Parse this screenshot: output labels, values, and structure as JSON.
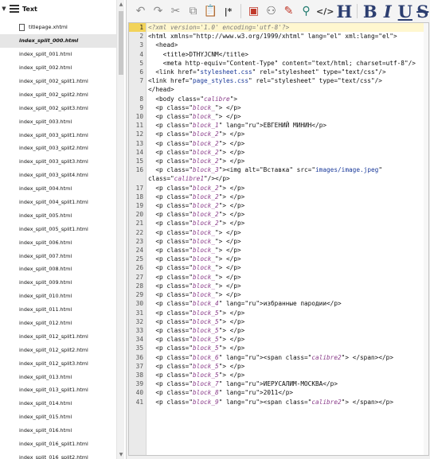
{
  "tree": {
    "root_label": "Text",
    "items": [
      {
        "label": "titlepage.xhtml",
        "selected": false
      },
      {
        "label": "index_split_000.html",
        "selected": true
      },
      {
        "label": "index_split_001.html",
        "selected": false
      },
      {
        "label": "index_split_002.html",
        "selected": false
      },
      {
        "label": "index_split_002_split1.html",
        "selected": false
      },
      {
        "label": "index_split_002_split2.html",
        "selected": false
      },
      {
        "label": "index_split_002_split3.html",
        "selected": false
      },
      {
        "label": "index_split_003.html",
        "selected": false
      },
      {
        "label": "index_split_003_split1.html",
        "selected": false
      },
      {
        "label": "index_split_003_split2.html",
        "selected": false
      },
      {
        "label": "index_split_003_split3.html",
        "selected": false
      },
      {
        "label": "index_split_003_split4.html",
        "selected": false
      },
      {
        "label": "index_split_004.html",
        "selected": false
      },
      {
        "label": "index_split_004_split1.html",
        "selected": false
      },
      {
        "label": "index_split_005.html",
        "selected": false
      },
      {
        "label": "index_split_005_split1.html",
        "selected": false
      },
      {
        "label": "index_split_006.html",
        "selected": false
      },
      {
        "label": "index_split_007.html",
        "selected": false
      },
      {
        "label": "index_split_008.html",
        "selected": false
      },
      {
        "label": "index_split_009.html",
        "selected": false
      },
      {
        "label": "index_split_010.html",
        "selected": false
      },
      {
        "label": "index_split_011.html",
        "selected": false
      },
      {
        "label": "index_split_012.html",
        "selected": false
      },
      {
        "label": "index_split_012_split1.html",
        "selected": false
      },
      {
        "label": "index_split_012_split2.html",
        "selected": false
      },
      {
        "label": "index_split_012_split3.html",
        "selected": false
      },
      {
        "label": "index_split_013.html",
        "selected": false
      },
      {
        "label": "index_split_013_split1.html",
        "selected": false
      },
      {
        "label": "index_split_014.html",
        "selected": false
      },
      {
        "label": "index_split_015.html",
        "selected": false
      },
      {
        "label": "index_split_016.html",
        "selected": false
      },
      {
        "label": "index_split_016_split1.html",
        "selected": false
      },
      {
        "label": "index_split_016_split2.html",
        "selected": false
      }
    ]
  },
  "toolbar": {
    "buttons": [
      {
        "name": "undo-icon",
        "glyph": "↶",
        "style": "muted"
      },
      {
        "name": "redo-icon",
        "glyph": "↷",
        "style": "muted"
      },
      {
        "name": "cut-icon",
        "glyph": "✂",
        "style": "muted"
      },
      {
        "name": "copy-icon",
        "glyph": "⧉",
        "style": "muted"
      },
      {
        "name": "paste-icon",
        "glyph": "📋",
        "style": ""
      },
      {
        "name": "split-chapter-icon",
        "glyph": "|*",
        "style": "code"
      },
      {
        "name": "sep",
        "glyph": "",
        "style": "sep"
      },
      {
        "name": "insert-image-icon",
        "glyph": "▣",
        "style": "red"
      },
      {
        "name": "insert-special-char-icon",
        "glyph": "⚇",
        "style": ""
      },
      {
        "name": "spellcheck-icon",
        "glyph": "✎",
        "style": "red"
      },
      {
        "name": "find-replace-icon",
        "glyph": "⚲",
        "style": "teal"
      },
      {
        "name": "insert-tag-icon",
        "glyph": "</>",
        "style": "code"
      },
      {
        "name": "heading-icon",
        "glyph": "H",
        "style": "big"
      },
      {
        "name": "sep",
        "glyph": "",
        "style": "sep"
      },
      {
        "name": "bold-icon",
        "glyph": "B",
        "style": "big"
      },
      {
        "name": "italic-icon",
        "glyph": "I",
        "style": "big it"
      },
      {
        "name": "underline-icon",
        "glyph": "U",
        "style": "big ul"
      },
      {
        "name": "strikethrough-icon",
        "glyph": "S",
        "style": "big st"
      }
    ]
  },
  "editor": {
    "lines": [
      {
        "n": "1",
        "segs": [
          [
            "pi",
            "<?xml version='1.0' encoding='utf-8'?>"
          ]
        ]
      },
      {
        "n": "2",
        "segs": [
          [
            "tag",
            "<html xmlns=\"http://www.w3.org/1999/xhtml\" lang=\"el\" xml:lang=\"el\">"
          ]
        ]
      },
      {
        "n": "3",
        "segs": [
          [
            "tag",
            "  <head>"
          ]
        ]
      },
      {
        "n": "4",
        "segs": [
          [
            "tag",
            "    <title>"
          ],
          [
            "txt",
            "DTHYJCNM"
          ],
          [
            "tag",
            "</title>"
          ]
        ]
      },
      {
        "n": "5",
        "segs": [
          [
            "tag",
            "    <meta http-equiv=\"Content-Type\" content=\"text/html; charset=utf-8\"/>"
          ]
        ]
      },
      {
        "n": "6",
        "segs": [
          [
            "tag",
            "  <link href=\""
          ],
          [
            "href",
            "stylesheet.css"
          ],
          [
            "tag",
            "\" rel=\"stylesheet\" type=\"text/css\"/>"
          ]
        ]
      },
      {
        "n": "7",
        "segs": [
          [
            "tag",
            "<link href=\""
          ],
          [
            "href",
            "page_styles.css"
          ],
          [
            "tag",
            "\" rel=\"stylesheet\" type=\"text/css\"/>"
          ]
        ]
      },
      {
        "n": "",
        "segs": [
          [
            "tag",
            "</head>"
          ]
        ]
      },
      {
        "n": "8",
        "segs": [
          [
            "tag",
            "  <body class=\""
          ],
          [
            "cls",
            "calibre"
          ],
          [
            "tag",
            "\">"
          ]
        ]
      },
      {
        "n": "9",
        "segs": [
          [
            "tag",
            "  <p class=\""
          ],
          [
            "cls",
            "block_"
          ],
          [
            "tag",
            "\"> </p>"
          ]
        ]
      },
      {
        "n": "10",
        "segs": [
          [
            "tag",
            "  <p class=\""
          ],
          [
            "cls",
            "block_"
          ],
          [
            "tag",
            "\"> </p>"
          ]
        ]
      },
      {
        "n": "11",
        "segs": [
          [
            "tag",
            "  <p class=\""
          ],
          [
            "cls",
            "block_1"
          ],
          [
            "tag",
            "\" lang=\"ru\">"
          ],
          [
            "txt",
            "ЕВГЕНИЙ МИНИН"
          ],
          [
            "tag",
            "</p>"
          ]
        ]
      },
      {
        "n": "12",
        "segs": [
          [
            "tag",
            "  <p class=\""
          ],
          [
            "cls",
            "block_2"
          ],
          [
            "tag",
            "\"> </p>"
          ]
        ]
      },
      {
        "n": "13",
        "segs": [
          [
            "tag",
            "  <p class=\""
          ],
          [
            "cls",
            "block_2"
          ],
          [
            "tag",
            "\"> </p>"
          ]
        ]
      },
      {
        "n": "14",
        "segs": [
          [
            "tag",
            "  <p class=\""
          ],
          [
            "cls",
            "block_2"
          ],
          [
            "tag",
            "\"> </p>"
          ]
        ]
      },
      {
        "n": "15",
        "segs": [
          [
            "tag",
            "  <p class=\""
          ],
          [
            "cls",
            "block_2"
          ],
          [
            "tag",
            "\"> </p>"
          ]
        ]
      },
      {
        "n": "16",
        "segs": [
          [
            "tag",
            "  <p class=\""
          ],
          [
            "cls",
            "block_3"
          ],
          [
            "tag",
            "\"><img alt=\"Вставка\" src=\""
          ],
          [
            "href",
            "images/image.jpeg"
          ],
          [
            "tag",
            "\" class=\""
          ],
          [
            "cls",
            "calibre1"
          ],
          [
            "tag",
            "\"/></p>"
          ]
        ]
      },
      {
        "n": "17",
        "segs": [
          [
            "tag",
            "  <p class=\""
          ],
          [
            "cls",
            "block_2"
          ],
          [
            "tag",
            "\"> </p>"
          ]
        ]
      },
      {
        "n": "18",
        "segs": [
          [
            "tag",
            "  <p class=\""
          ],
          [
            "cls",
            "block_2"
          ],
          [
            "tag",
            "\"> </p>"
          ]
        ]
      },
      {
        "n": "19",
        "segs": [
          [
            "tag",
            "  <p class=\""
          ],
          [
            "cls",
            "block_2"
          ],
          [
            "tag",
            "\"> </p>"
          ]
        ]
      },
      {
        "n": "20",
        "segs": [
          [
            "tag",
            "  <p class=\""
          ],
          [
            "cls",
            "block_2"
          ],
          [
            "tag",
            "\"> </p>"
          ]
        ]
      },
      {
        "n": "21",
        "segs": [
          [
            "tag",
            "  <p class=\""
          ],
          [
            "cls",
            "block_2"
          ],
          [
            "tag",
            "\"> </p>"
          ]
        ]
      },
      {
        "n": "22",
        "segs": [
          [
            "tag",
            "  <p class=\""
          ],
          [
            "cls",
            "block_"
          ],
          [
            "tag",
            "\"> </p>"
          ]
        ]
      },
      {
        "n": "23",
        "segs": [
          [
            "tag",
            "  <p class=\""
          ],
          [
            "cls",
            "block_"
          ],
          [
            "tag",
            "\"> </p>"
          ]
        ]
      },
      {
        "n": "24",
        "segs": [
          [
            "tag",
            "  <p class=\""
          ],
          [
            "cls",
            "block_"
          ],
          [
            "tag",
            "\"> </p>"
          ]
        ]
      },
      {
        "n": "25",
        "segs": [
          [
            "tag",
            "  <p class=\""
          ],
          [
            "cls",
            "block_"
          ],
          [
            "tag",
            "\"> </p>"
          ]
        ]
      },
      {
        "n": "26",
        "segs": [
          [
            "tag",
            "  <p class=\""
          ],
          [
            "cls",
            "block_"
          ],
          [
            "tag",
            "\"> </p>"
          ]
        ]
      },
      {
        "n": "27",
        "segs": [
          [
            "tag",
            "  <p class=\""
          ],
          [
            "cls",
            "block_"
          ],
          [
            "tag",
            "\"> </p>"
          ]
        ]
      },
      {
        "n": "28",
        "segs": [
          [
            "tag",
            "  <p class=\""
          ],
          [
            "cls",
            "block_"
          ],
          [
            "tag",
            "\"> </p>"
          ]
        ]
      },
      {
        "n": "29",
        "segs": [
          [
            "tag",
            "  <p class=\""
          ],
          [
            "cls",
            "block_"
          ],
          [
            "tag",
            "\"> </p>"
          ]
        ]
      },
      {
        "n": "30",
        "segs": [
          [
            "tag",
            "  <p class=\""
          ],
          [
            "cls",
            "block_4"
          ],
          [
            "tag",
            "\" lang=\"ru\">"
          ],
          [
            "txt",
            "избранные пародии"
          ],
          [
            "tag",
            "</p>"
          ]
        ]
      },
      {
        "n": "31",
        "segs": [
          [
            "tag",
            "  <p class=\""
          ],
          [
            "cls",
            "block_5"
          ],
          [
            "tag",
            "\"> </p>"
          ]
        ]
      },
      {
        "n": "32",
        "segs": [
          [
            "tag",
            "  <p class=\""
          ],
          [
            "cls",
            "block_5"
          ],
          [
            "tag",
            "\"> </p>"
          ]
        ]
      },
      {
        "n": "33",
        "segs": [
          [
            "tag",
            "  <p class=\""
          ],
          [
            "cls",
            "block_5"
          ],
          [
            "tag",
            "\"> </p>"
          ]
        ]
      },
      {
        "n": "34",
        "segs": [
          [
            "tag",
            "  <p class=\""
          ],
          [
            "cls",
            "block_5"
          ],
          [
            "tag",
            "\"> </p>"
          ]
        ]
      },
      {
        "n": "35",
        "segs": [
          [
            "tag",
            "  <p class=\""
          ],
          [
            "cls",
            "block_5"
          ],
          [
            "tag",
            "\"> </p>"
          ]
        ]
      },
      {
        "n": "36",
        "segs": [
          [
            "tag",
            "  <p class=\""
          ],
          [
            "cls",
            "block_6"
          ],
          [
            "tag",
            "\" lang=\"ru\"><span class=\""
          ],
          [
            "cls",
            "calibre2"
          ],
          [
            "tag",
            "\"> </span></p>"
          ]
        ]
      },
      {
        "n": "37",
        "segs": [
          [
            "tag",
            "  <p class=\""
          ],
          [
            "cls",
            "block_5"
          ],
          [
            "tag",
            "\"> </p>"
          ]
        ]
      },
      {
        "n": "38",
        "segs": [
          [
            "tag",
            "  <p class=\""
          ],
          [
            "cls",
            "block_5"
          ],
          [
            "tag",
            "\"> </p>"
          ]
        ]
      },
      {
        "n": "39",
        "segs": [
          [
            "tag",
            "  <p class=\""
          ],
          [
            "cls",
            "block_7"
          ],
          [
            "tag",
            "\" lang=\"ru\">"
          ],
          [
            "txt",
            "ИЕРУСАЛИМ-МОСКВА"
          ],
          [
            "tag",
            "</p>"
          ]
        ]
      },
      {
        "n": "40",
        "segs": [
          [
            "tag",
            "  <p class=\""
          ],
          [
            "cls",
            "block_8"
          ],
          [
            "tag",
            "\" lang=\"ru\">"
          ],
          [
            "txt",
            "2011"
          ],
          [
            "tag",
            "</p>"
          ]
        ]
      },
      {
        "n": "41",
        "segs": [
          [
            "tag",
            "  <p class=\""
          ],
          [
            "cls",
            "block_9"
          ],
          [
            "tag",
            "\" lang=\"ru\"><span class=\""
          ],
          [
            "cls",
            "calibre2"
          ],
          [
            "tag",
            "\"> </span></p>"
          ]
        ]
      }
    ]
  }
}
